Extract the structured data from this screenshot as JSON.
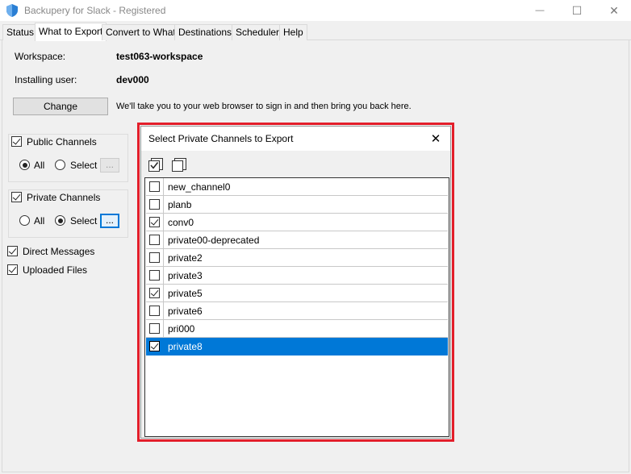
{
  "window": {
    "title": "Backupery for Slack - Registered",
    "controls": {
      "minimize": "—",
      "maximize": "☐",
      "close": "✕"
    }
  },
  "tabs": [
    {
      "label": "Status",
      "active": false
    },
    {
      "label": "What to Export",
      "active": true
    },
    {
      "label": "Convert to What",
      "active": false
    },
    {
      "label": "Destinations",
      "active": false
    },
    {
      "label": "Scheduler",
      "active": false
    },
    {
      "label": "Help",
      "active": false
    }
  ],
  "account": {
    "workspace_label": "Workspace:",
    "workspace_value": "test063-workspace",
    "user_label": "Installing user:",
    "user_value": "dev000",
    "change_button": "Change",
    "change_hint": "We'll take you to your web browser to sign in and then bring you back here."
  },
  "public_channels": {
    "label": "Public Channels",
    "checked": true,
    "option_all": "All",
    "option_select": "Select",
    "selected_option": "all",
    "dots_label": "..."
  },
  "private_channels": {
    "label": "Private Channels",
    "checked": true,
    "option_all": "All",
    "option_select": "Select",
    "selected_option": "select",
    "dots_label": "..."
  },
  "direct_messages": {
    "label": "Direct Messages",
    "checked": true
  },
  "uploaded_files": {
    "label": "Uploaded Files",
    "checked": true
  },
  "dialog": {
    "title": "Select Private Channels to Export",
    "close_glyph": "✕",
    "channels": [
      {
        "name": "new_channel0",
        "checked": false,
        "selected": false
      },
      {
        "name": "planb",
        "checked": false,
        "selected": false
      },
      {
        "name": "conv0",
        "checked": true,
        "selected": false
      },
      {
        "name": "private00-deprecated",
        "checked": false,
        "selected": false
      },
      {
        "name": "private2",
        "checked": false,
        "selected": false
      },
      {
        "name": "private3",
        "checked": false,
        "selected": false
      },
      {
        "name": "private5",
        "checked": true,
        "selected": false
      },
      {
        "name": "private6",
        "checked": false,
        "selected": false
      },
      {
        "name": "pri000",
        "checked": false,
        "selected": false
      },
      {
        "name": "private8",
        "checked": true,
        "selected": true
      }
    ]
  },
  "colors": {
    "selection": "#0078d7",
    "highlight_border": "#e31e2a",
    "app_icon": "#2a7fd4"
  },
  "icons": {
    "app": "shield-icon",
    "select_all": "check-all-icon",
    "deselect_all": "uncheck-all-icon"
  }
}
